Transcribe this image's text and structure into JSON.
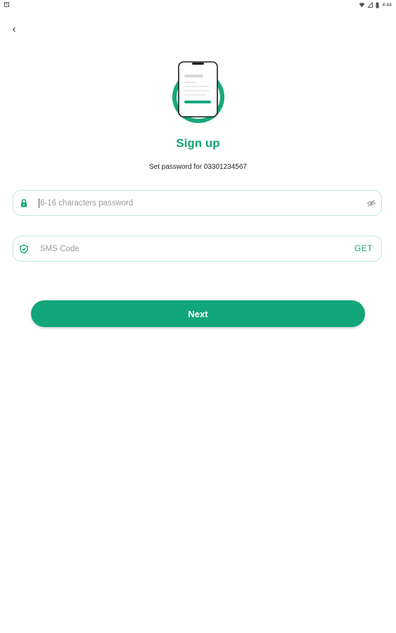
{
  "status_bar": {
    "time": "4:44",
    "icons": [
      "notification-icon",
      "wifi-icon",
      "signal-icon",
      "battery-icon"
    ]
  },
  "nav": {
    "back_icon": "chevron-left-icon"
  },
  "header": {
    "title": "Sign up",
    "subtitle": "Set password for 03301234567"
  },
  "password_field": {
    "placeholder": "6-16 characters password",
    "value": "",
    "icon": "lock-icon",
    "toggle_icon": "eye-off-icon"
  },
  "sms_field": {
    "placeholder": "SMS Code",
    "value": "",
    "icon": "shield-check-icon",
    "action_label": "GET"
  },
  "next_button": {
    "label": "Next"
  },
  "colors": {
    "accent": "#15a37a",
    "button": "#11a67a",
    "field_border": "#bfe8d9"
  }
}
